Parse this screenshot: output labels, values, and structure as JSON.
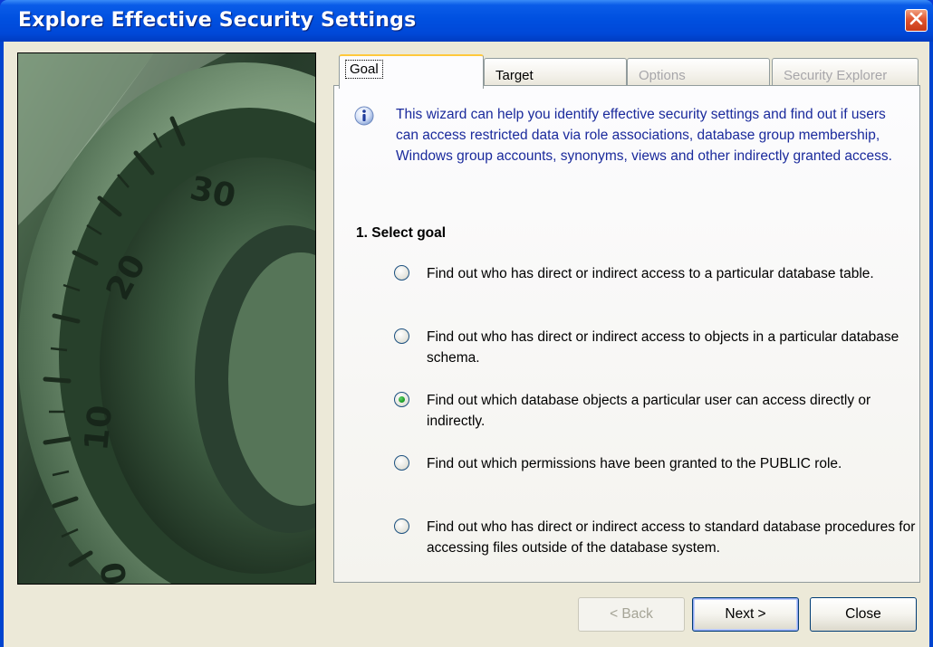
{
  "window": {
    "title": "Explore Effective Security Settings",
    "accent_color": "#0054e3",
    "icon": "close-icon"
  },
  "tabs": [
    {
      "label": "Goal",
      "state": "active"
    },
    {
      "label": "Target",
      "state": "enabled"
    },
    {
      "label": "Options",
      "state": "disabled"
    },
    {
      "label": "Security Explorer",
      "state": "disabled"
    }
  ],
  "info": {
    "icon": "info-icon",
    "text": "This wizard can help you identify effective security settings and find out if users can access restricted data via role associations, database group membership, Windows group accounts, synonyms, views and other indirectly granted access."
  },
  "goal": {
    "title": "1. Select goal",
    "selected_index": 2,
    "options": [
      {
        "label": "Find out who has direct or indirect access to a particular database table."
      },
      {
        "label": "Find out who has direct or indirect access to objects in a particular database schema."
      },
      {
        "label": "Find out which database objects a particular user can access directly or indirectly."
      },
      {
        "label": "Find out which permissions have been granted to the PUBLIC role."
      },
      {
        "label": "Find out who has direct or indirect access to standard database procedures for accessing files outside of the database system."
      }
    ]
  },
  "buttons": {
    "back": "< Back",
    "next": "Next >",
    "close": "Close"
  },
  "image": {
    "description_icon": "combination-lock-dial-image",
    "dial_numbers": [
      "30",
      "20",
      "10",
      "0"
    ]
  }
}
